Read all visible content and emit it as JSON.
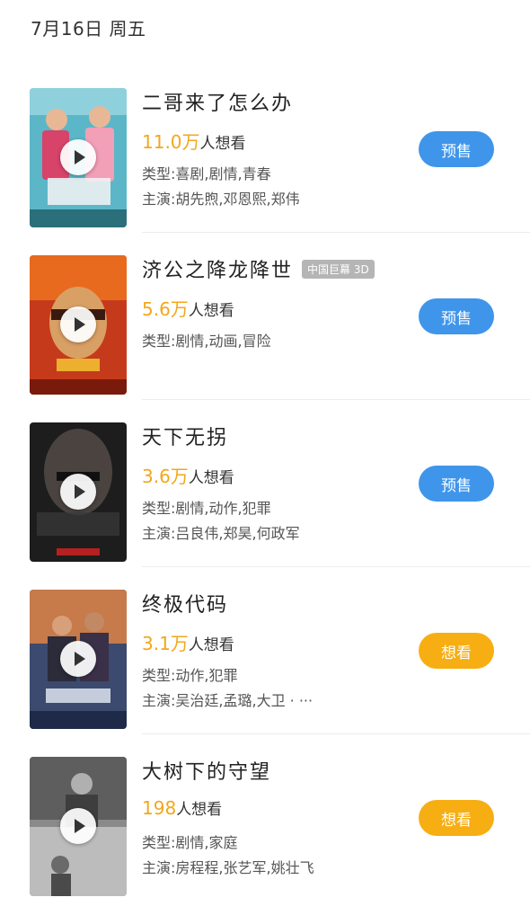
{
  "header": {
    "date": "7月16日 周五"
  },
  "colors": {
    "presale": "#3f95ea",
    "want": "#f7ae13",
    "want_count": "#f2a71b"
  },
  "movies": [
    {
      "title": "二哥来了怎么办",
      "badge": "",
      "want_count": "11.0万",
      "want_suffix": "人想看",
      "genre": "类型:喜剧,剧情,青春",
      "cast": "主演:胡先煦,邓恩熙,郑伟",
      "action": "预售",
      "action_type": "presale"
    },
    {
      "title": "济公之降龙降世",
      "badge": "中国巨幕 3D",
      "want_count": "5.6万",
      "want_suffix": "人想看",
      "genre": "类型:剧情,动画,冒险",
      "cast": "",
      "action": "预售",
      "action_type": "presale"
    },
    {
      "title": "天下无拐",
      "badge": "",
      "want_count": "3.6万",
      "want_suffix": "人想看",
      "genre": "类型:剧情,动作,犯罪",
      "cast": "主演:吕良伟,郑昊,何政军",
      "action": "预售",
      "action_type": "presale"
    },
    {
      "title": "终极代码",
      "badge": "",
      "want_count": "3.1万",
      "want_suffix": "人想看",
      "genre": "类型:动作,犯罪",
      "cast": "主演:吴治廷,孟璐,大卫 · ···",
      "action": "想看",
      "action_type": "want"
    },
    {
      "title": "大树下的守望",
      "badge": "",
      "want_count": "198",
      "want_suffix": "人想看",
      "genre": "类型:剧情,家庭",
      "cast": "主演:房程程,张艺军,姚壮飞",
      "action": "想看",
      "action_type": "want"
    }
  ]
}
